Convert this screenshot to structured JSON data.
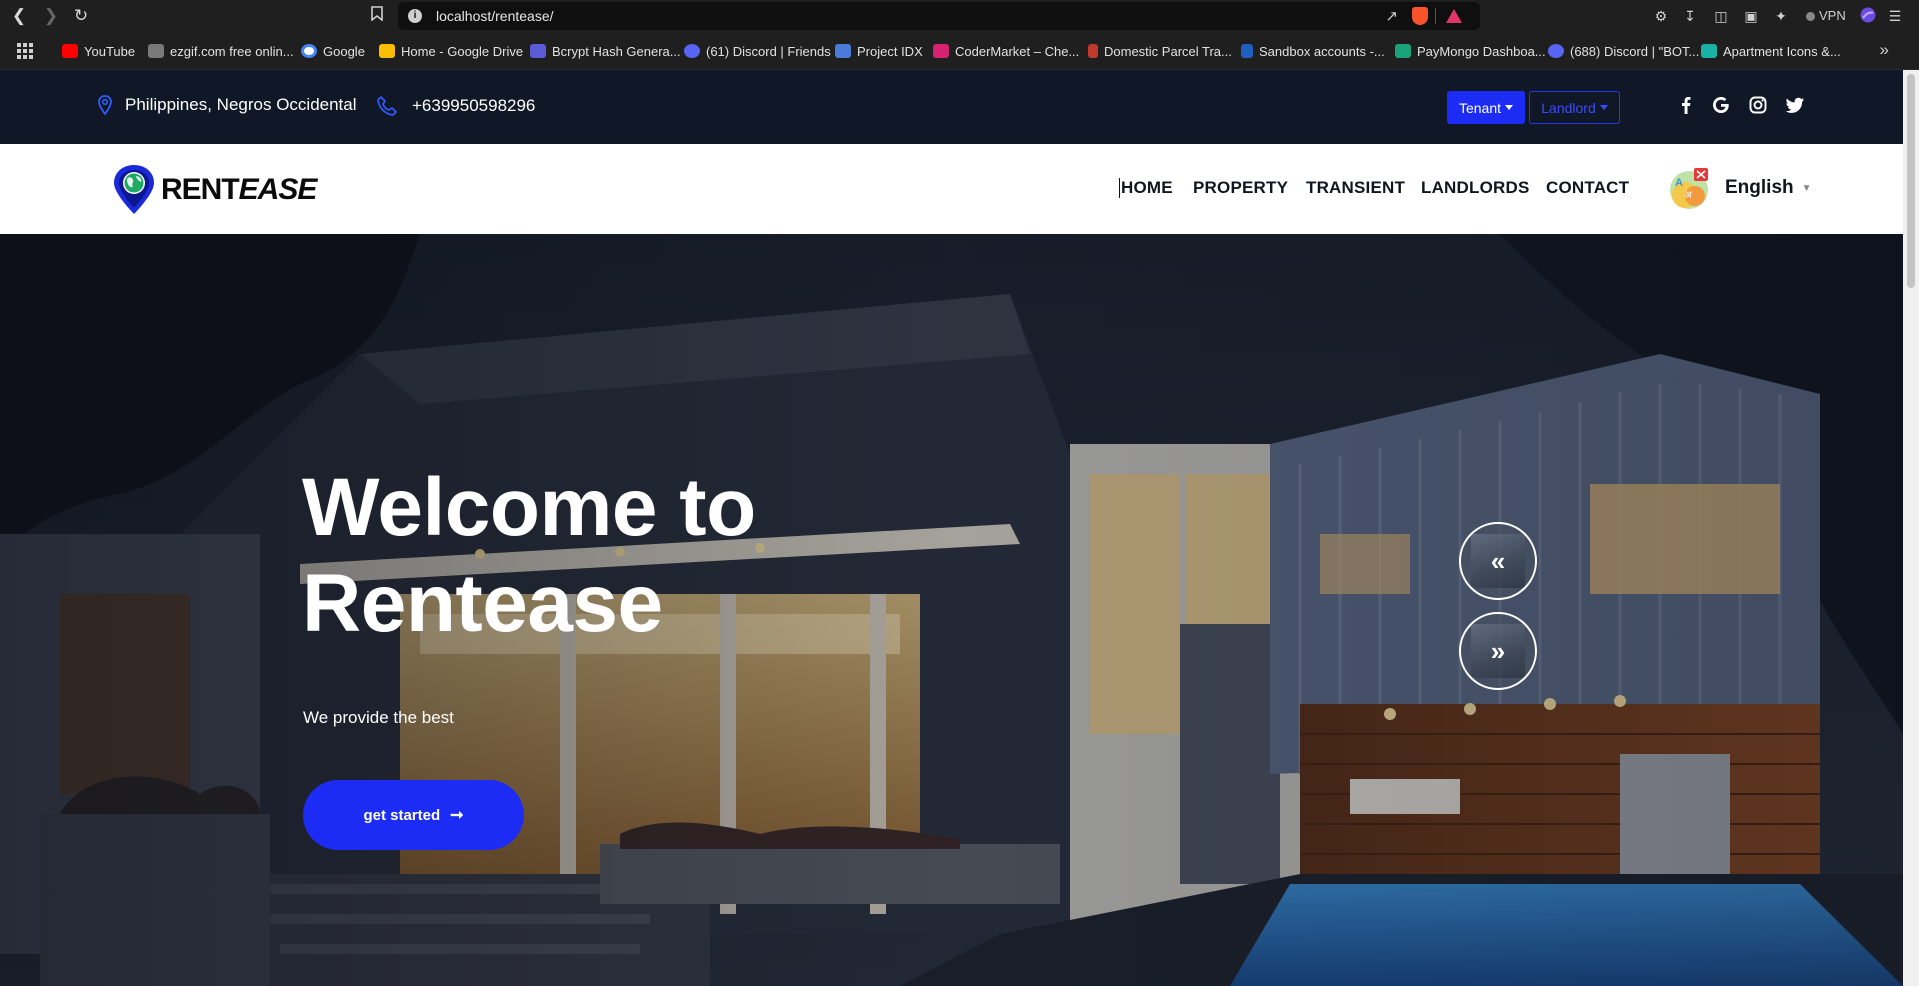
{
  "browser": {
    "url": "localhost/rentease/",
    "vpn_label": "VPN",
    "bookmarks": [
      {
        "label": "YouTube",
        "color": "#ff0000"
      },
      {
        "label": "ezgif.com free onlin...",
        "color": "#7a7a7a"
      },
      {
        "label": "Google",
        "color": "#4285f4"
      },
      {
        "label": "Home - Google Drive",
        "color": "#fbbc04"
      },
      {
        "label": "Bcrypt Hash Genera...",
        "color": "#5b5bd6"
      },
      {
        "label": "(61) Discord | Friends",
        "color": "#5865f2"
      },
      {
        "label": "Project IDX",
        "color": "#4a7bd8"
      },
      {
        "label": "CoderMarket – Che...",
        "color": "#d6236f"
      },
      {
        "label": "Domestic Parcel Tra...",
        "color": "#c0392b"
      },
      {
        "label": "Sandbox accounts -...",
        "color": "#1f5fbf"
      },
      {
        "label": "PayMongo Dashboa...",
        "color": "#1aa37a"
      },
      {
        "label": "(688) Discord | \"BOT...",
        "color": "#5865f2"
      },
      {
        "label": "Apartment Icons &...",
        "color": "#19b3a6"
      }
    ]
  },
  "topbar": {
    "location": "Philippines, Negros Occidental",
    "phone": "+639950598296",
    "tenant_label": "Tenant",
    "landlord_label": "Landlord"
  },
  "navbar": {
    "logo_plain": "RENT",
    "logo_italic": "EASE",
    "menu": [
      "HOME",
      "PROPERTY",
      "TRANSIENT",
      "LANDLORDS",
      "CONTACT"
    ],
    "language": "English"
  },
  "hero": {
    "title_line1": "Welcome to",
    "title_line2": "Rentease",
    "subtitle": "We provide the best",
    "cta_label": "get started",
    "prev_glyph": "«",
    "next_glyph": "»"
  },
  "colors": {
    "brand_blue": "#1c2cf5",
    "topbar_bg": "#101827"
  }
}
